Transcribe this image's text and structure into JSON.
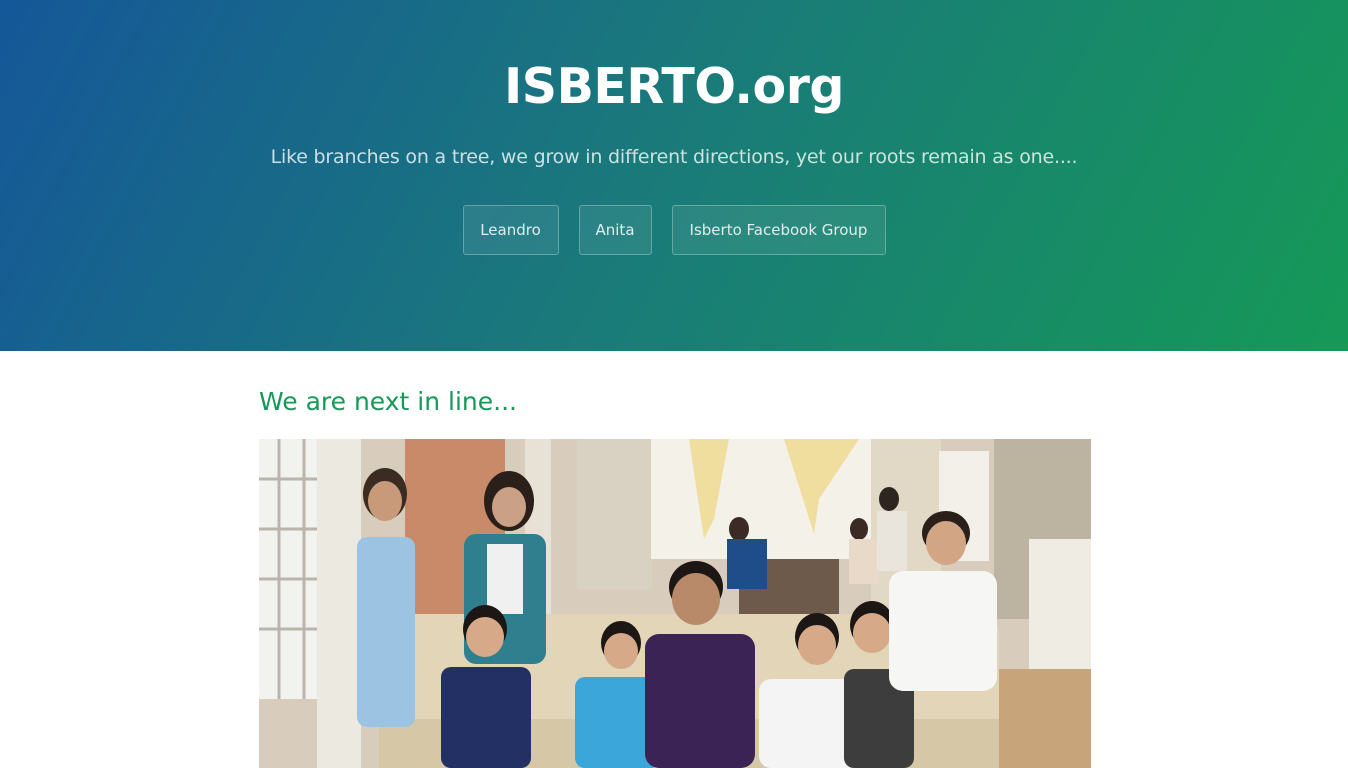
{
  "header": {
    "title": "ISBERTO.org",
    "tagline": "Like branches on a tree, we grow in different directions, yet our roots remain as one....",
    "buttons": [
      {
        "label": "Leandro"
      },
      {
        "label": "Anita"
      },
      {
        "label": "Isberto Facebook Group"
      }
    ]
  },
  "main": {
    "heading": "We are next in line...",
    "photo": {
      "subject": "family-group-photo"
    }
  },
  "colors": {
    "gradient_start": "#155799",
    "gradient_end": "#159957",
    "heading": "#159957"
  }
}
